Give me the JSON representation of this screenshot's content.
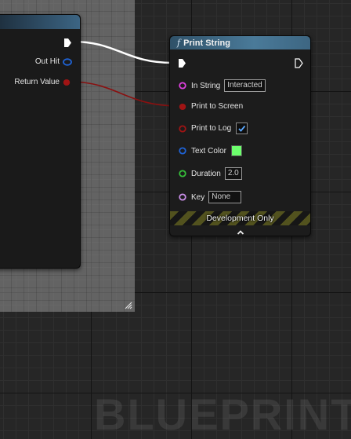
{
  "canvas": {
    "watermark": "BLUEPRINT"
  },
  "left_node": {
    "pins": [
      {
        "label": "",
        "type": "exec",
        "color": "#ffffff"
      },
      {
        "label": "Out Hit",
        "type": "struct",
        "color": "#1f63d6"
      },
      {
        "label": "Return Value",
        "type": "bool",
        "color": "#a01414"
      }
    ]
  },
  "print_string": {
    "icon": "function-icon",
    "icon_glyph": "f",
    "title": "Print String",
    "pins": {
      "in_string": {
        "label": "In String",
        "value": "Interacted",
        "color": "#e040e0"
      },
      "print_to_screen": {
        "label": "Print to Screen",
        "color": "#a01414"
      },
      "print_to_log": {
        "label": "Print to Log",
        "checked": true,
        "color": "#a01414"
      },
      "text_color": {
        "label": "Text Color",
        "value": "#6dff6d",
        "color": "#1f63d6"
      },
      "duration": {
        "label": "Duration",
        "value": "2.0",
        "color": "#36c03a"
      },
      "key": {
        "label": "Key",
        "value": "None",
        "color": "#c98ee8"
      }
    },
    "footer": "Development Only",
    "footer_stripe_color": "#52521e"
  },
  "wires": {
    "exec_color": "#ffffff",
    "bool_color": "#8a1010"
  }
}
